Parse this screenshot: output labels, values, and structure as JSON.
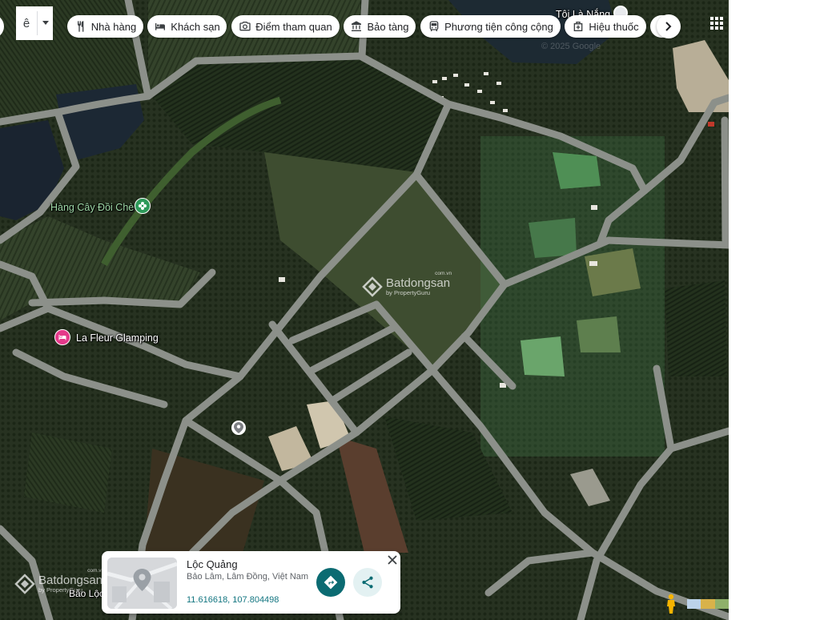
{
  "search": {
    "input_method_label": "ê"
  },
  "categories": [
    {
      "label": "Nhà hàng",
      "icon": "restaurant-icon"
    },
    {
      "label": "Khách sạn",
      "icon": "hotel-icon"
    },
    {
      "label": "Điểm tham quan",
      "icon": "camera-icon"
    },
    {
      "label": "Bảo tàng",
      "icon": "museum-icon"
    },
    {
      "label": "Phương tiện công cộng",
      "icon": "transit-icon"
    },
    {
      "label": "Hiệu thuốc",
      "icon": "pharmacy-icon"
    }
  ],
  "controls": {
    "chips_next_icon": "chevron-right-icon",
    "apps_icon": "apps-grid-icon",
    "pegman_icon": "pegman-icon",
    "layers_icon": "layers-thumbnail-icon"
  },
  "map": {
    "copyright": "© 2025 Google",
    "labels": {
      "top_place": "Tôi Là Nắng",
      "tea_tree_row": "Hàng Cây Đồi Chè",
      "glamping": "La Fleur Glamping",
      "city": "Bảo Lộc"
    },
    "label_icons": {
      "tea_tree_row": "park-icon",
      "glamping": "lodging-icon",
      "dropped_pin": "map-pin-icon"
    }
  },
  "watermark": {
    "brand": "Batdongsan",
    "tagline": "by PropertyGuru",
    "domain": "com.vn"
  },
  "place_card": {
    "title": "Lộc Quảng",
    "address": "Bảo Lâm, Lâm Đồng, Việt Nam",
    "coordinates": "11.616618, 107.804498",
    "directions_icon": "directions-icon",
    "share_icon": "share-icon",
    "close_icon": "close-icon"
  },
  "colors": {
    "accent_teal": "#0b6b72",
    "share_bg": "#e3f1f2",
    "park_label": "#9fd9a8",
    "park_icon": "#2e9a5a",
    "lodging_icon": "#e4398a",
    "pegman": "#f5b400"
  }
}
